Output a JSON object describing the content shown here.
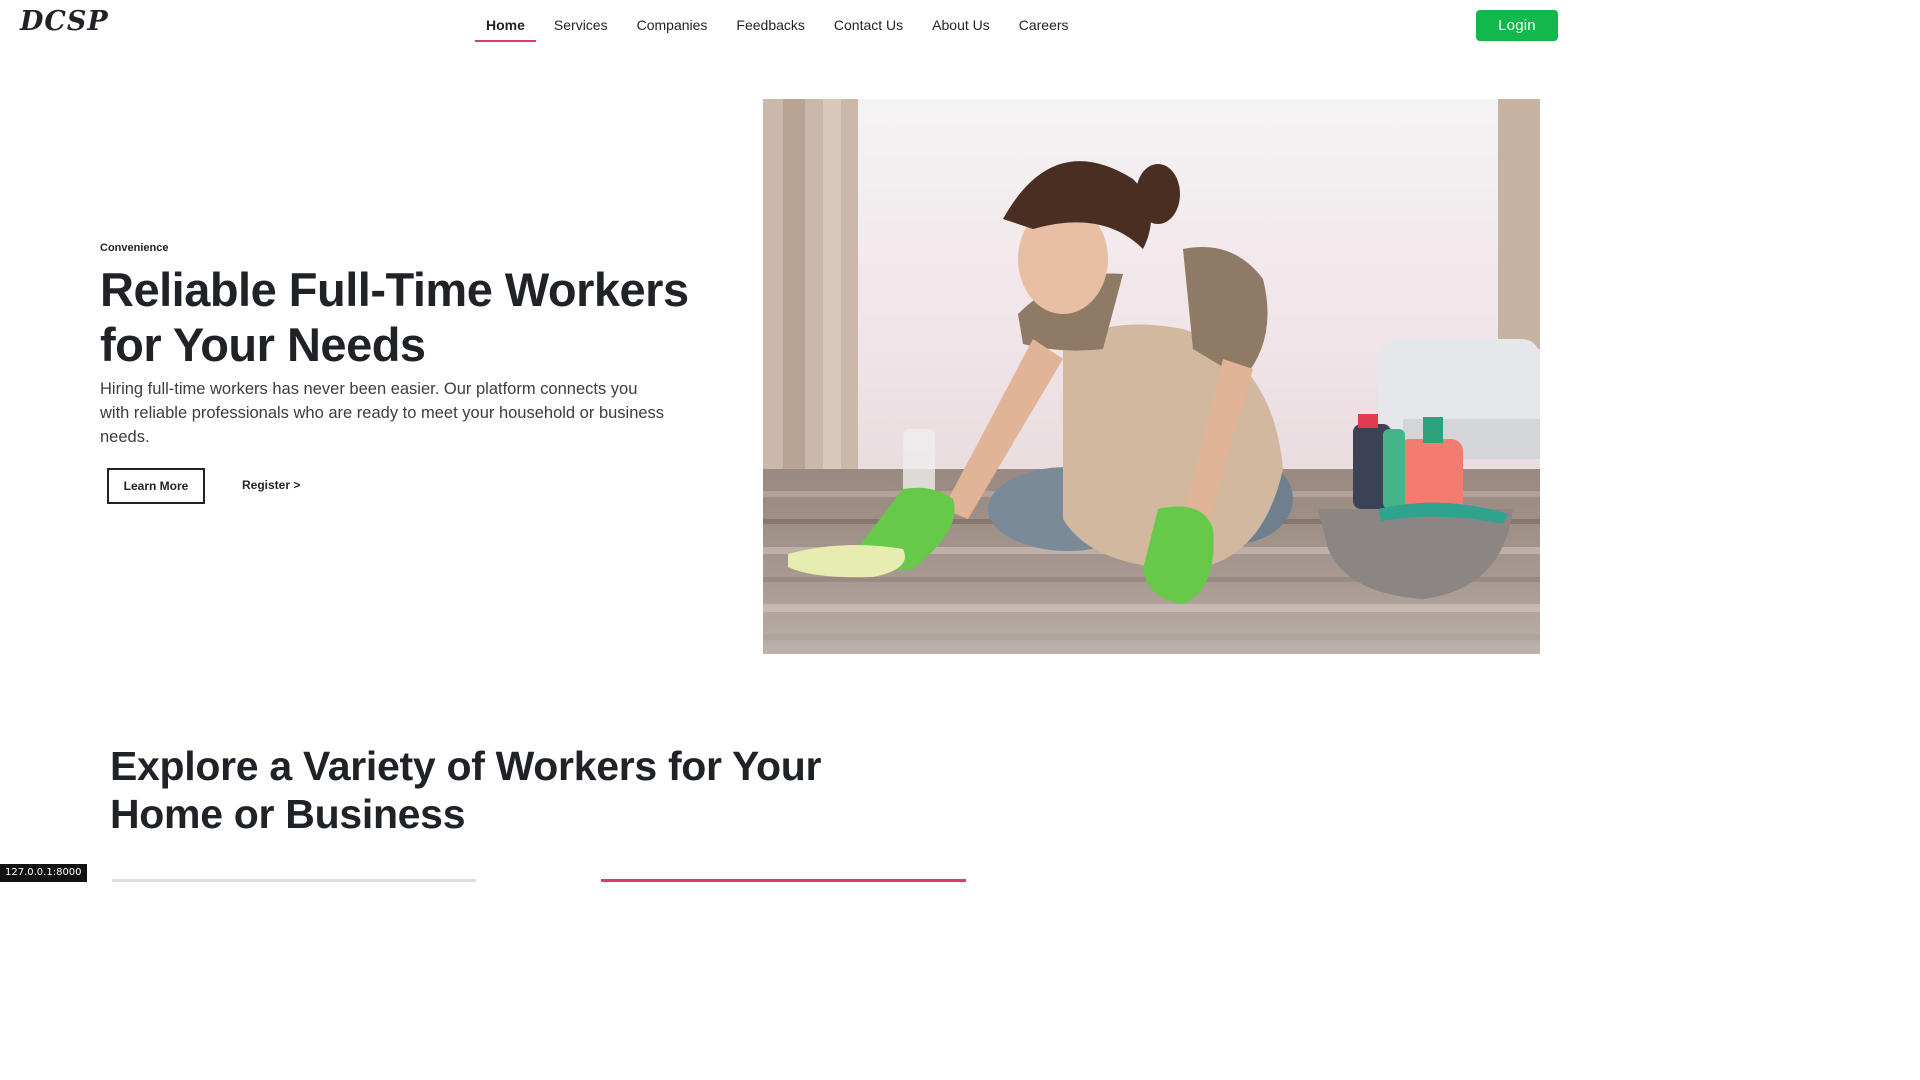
{
  "header": {
    "logo": "DCSP",
    "nav": [
      {
        "label": "Home",
        "active": true
      },
      {
        "label": "Services"
      },
      {
        "label": "Companies"
      },
      {
        "label": "Feedbacks"
      },
      {
        "label": "Contact Us"
      },
      {
        "label": "About Us"
      },
      {
        "label": "Careers"
      }
    ],
    "login_label": "Login"
  },
  "hero": {
    "eyebrow": "Convenience",
    "title": "Reliable Full-Time Workers for Your Needs",
    "description": "Hiring full-time workers has never been easier. Our platform connects you with reliable professionals who are ready to meet your household or business needs.",
    "learn_more_label": "Learn More",
    "register_label": "Register >"
  },
  "section": {
    "title": "Explore a Variety of Workers for Your Home or Business"
  },
  "status_bar": "127.0.0.1:8000",
  "colors": {
    "accent": "#e3386a",
    "login_green": "#12b84b",
    "text_dark": "#1f2226"
  }
}
